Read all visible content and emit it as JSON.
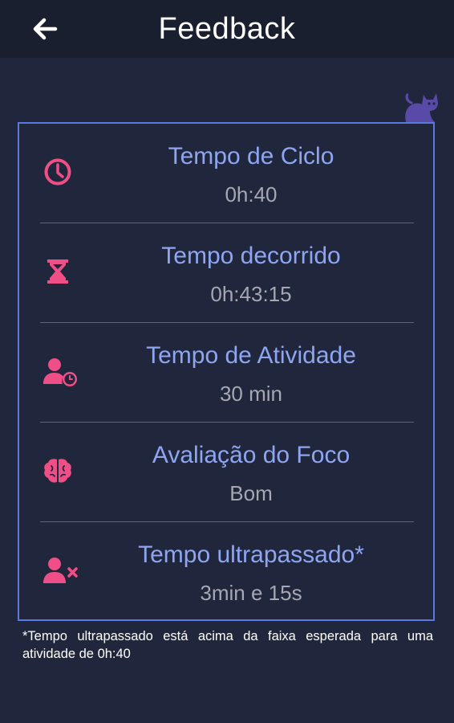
{
  "header": {
    "title": "Feedback",
    "back_icon": "arrow-left-icon"
  },
  "colors": {
    "background": "#20263b",
    "appbar": "#1a1f30",
    "card_border": "#5b77e0",
    "label": "#8ea6f2",
    "value": "#a5a8b2",
    "icon": "#ef4f86",
    "cat": "#5a4aa8"
  },
  "mascot_icon": "cat-icon",
  "metrics": [
    {
      "icon": "clock-icon",
      "label": "Tempo de Ciclo",
      "value": "0h:40"
    },
    {
      "icon": "hourglass-icon",
      "label": "Tempo decorrido",
      "value": "0h:43:15"
    },
    {
      "icon": "user-clock-icon",
      "label": "Tempo de Atividade",
      "value": "30 min"
    },
    {
      "icon": "brain-icon",
      "label": "Avaliação do Foco",
      "value": "Bom"
    },
    {
      "icon": "user-x-icon",
      "label": "Tempo ultrapassado*",
      "value": "3min e 15s"
    }
  ],
  "footnote": "*Tempo ultrapassado está acima da faixa esperada para uma atividade de 0h:40"
}
